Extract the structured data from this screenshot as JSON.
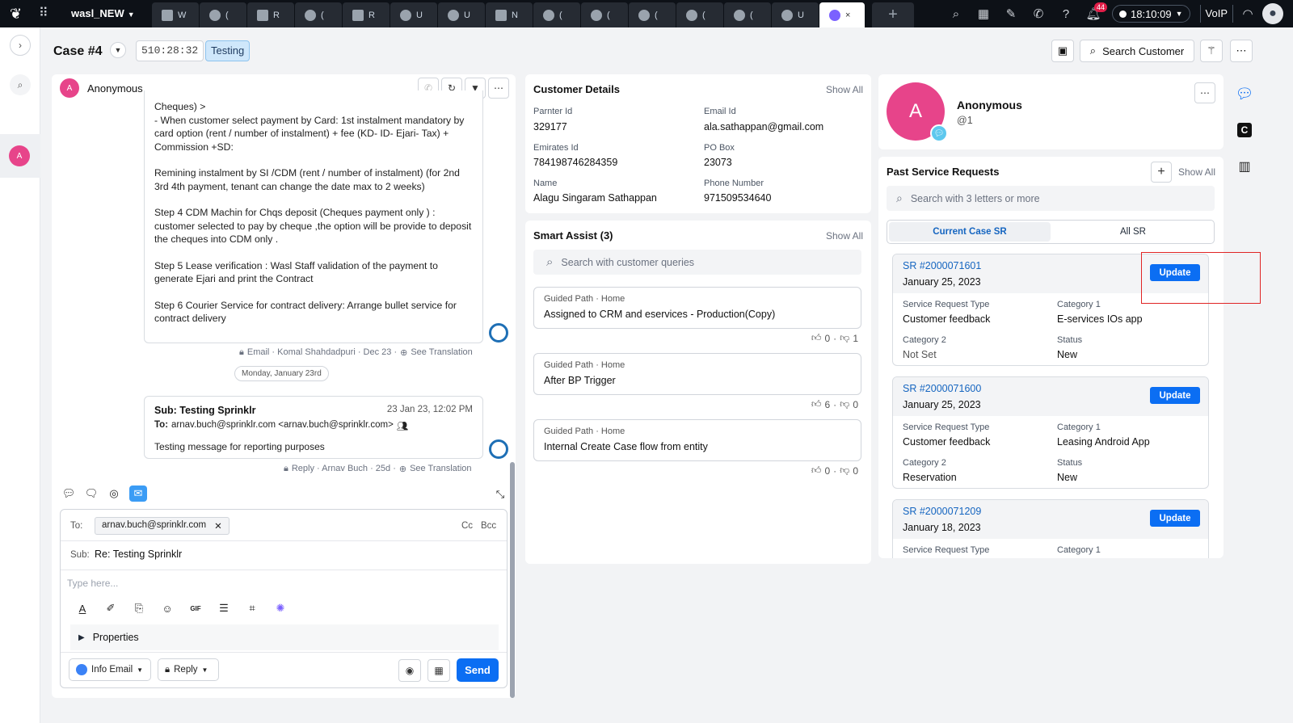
{
  "topbar": {
    "workspace": "wasl_NEW",
    "tabs": [
      {
        "letter": "W",
        "icon": "cube-icon"
      },
      {
        "letter": "(",
        "icon": "user-icon"
      },
      {
        "letter": "R",
        "icon": "cube-icon"
      },
      {
        "letter": "(",
        "icon": "user-icon"
      },
      {
        "letter": "R",
        "icon": "cube-icon"
      },
      {
        "letter": "U",
        "icon": "gear-icon"
      },
      {
        "letter": "U",
        "icon": "user-icon"
      },
      {
        "letter": "N",
        "icon": "cube-icon"
      },
      {
        "letter": "(",
        "icon": "user-icon"
      },
      {
        "letter": "(",
        "icon": "user-icon"
      },
      {
        "letter": "(",
        "icon": "user-icon"
      },
      {
        "letter": "(",
        "icon": "user-icon"
      },
      {
        "letter": "(",
        "icon": "user-icon"
      },
      {
        "letter": "U",
        "icon": "gear-icon"
      }
    ],
    "active_tab_close": "×",
    "plus": "+",
    "notif_count": "44",
    "clock": "18:10:09",
    "voip": "VoIP"
  },
  "header": {
    "case_title": "Case #4",
    "timer": "510:28:32",
    "status": "Testing",
    "search_customer": "Search Customer"
  },
  "conversation": {
    "name": "Anonymous",
    "avatar_letter": "A",
    "email_body": [
      "Cheques) >",
      "- When customer select payment by Card: 1st instalment mandatory by card option (rent / number of instalment) + fee (KD- ID- Ejari- Tax) + Commission +SD:",
      "Remining instalment by SI /CDM (rent / number of instalment) (for 2nd 3rd 4th payment, tenant can change the date max to 2 weeks)",
      "Step 4 CDM Machin for Chqs deposit (Cheques payment only ) : customer selected to pay by cheque ,the option will be provide to deposit the cheques into CDM only .",
      "Step 5 Lease verification : Wasl Staff validation of the payment to generate Ejari and print the Contract",
      "Step 6 Courier Service for contract delivery: Arrange bullet service for contract delivery"
    ],
    "meta1": "Email · Komal Shahdadpuri · Dec 23 ·",
    "see_translation": "See Translation",
    "day_divider": "Monday, January 23rd",
    "msg2_subject": "Sub: Testing Sprinklr",
    "msg2_date": "23 Jan 23, 12:02 PM",
    "msg2_to_label": "To:",
    "msg2_to": "arnav.buch@sprinklr.com <arnav.buch@sprinklr.com>",
    "msg2_body": "Testing message for reporting purposes",
    "meta2": "Reply · Arnav Buch · 25d ·"
  },
  "composer": {
    "to_label": "To:",
    "to_chip": "arnav.buch@sprinklr.com",
    "cc": "Cc",
    "bcc": "Bcc",
    "sub_label": "Sub:",
    "subject": "Re: Testing Sprinklr",
    "placeholder": "Type here...",
    "properties": "Properties",
    "from": "Info Email",
    "reply_mode": "Reply",
    "send": "Send"
  },
  "customer_details": {
    "title": "Customer Details",
    "show_all": "Show All",
    "fields": [
      {
        "label": "Parnter Id",
        "value": "329177"
      },
      {
        "label": "Email Id",
        "value": "ala.sathappan@gmail.com"
      },
      {
        "label": "Emirates Id",
        "value": "784198746284359"
      },
      {
        "label": "PO Box",
        "value": "23073"
      },
      {
        "label": "Name",
        "value": "Alagu Singaram Sathappan"
      },
      {
        "label": "Phone Number",
        "value": "971509534640"
      }
    ]
  },
  "smart_assist": {
    "title": "Smart Assist (3)",
    "show_all": "Show All",
    "search_placeholder": "Search with customer queries",
    "items": [
      {
        "crumb": "Guided Path · Home",
        "title": "Assigned to CRM and eservices - Production(Copy)",
        "up": "0",
        "down": "1"
      },
      {
        "crumb": "Guided Path · Home",
        "title": "After BP Trigger",
        "up": "6",
        "down": "0"
      },
      {
        "crumb": "Guided Path · Home",
        "title": "Internal Create Case flow from entity",
        "up": "0",
        "down": "0"
      }
    ]
  },
  "profile": {
    "letter": "A",
    "name": "Anonymous",
    "handle": "@1"
  },
  "past_sr": {
    "title": "Past Service Requests",
    "show_all": "Show All",
    "search_placeholder": "Search with 3 letters or more",
    "seg_current": "Current Case SR",
    "seg_all": "All SR",
    "update_label": "Update",
    "labels": {
      "type": "Service Request Type",
      "cat1": "Category 1",
      "cat2": "Category 2",
      "status": "Status"
    },
    "items": [
      {
        "number": "SR #2000071601",
        "date": "January 25, 2023",
        "type": "Customer feedback",
        "cat1": "E-services IOs app",
        "cat2": "Not Set",
        "status": "New"
      },
      {
        "number": "SR #2000071600",
        "date": "January 25, 2023",
        "type": "Customer feedback",
        "cat1": "Leasing Android App",
        "cat2": "Reservation",
        "status": "New"
      },
      {
        "number": "SR #2000071209",
        "date": "January 18, 2023"
      }
    ]
  }
}
